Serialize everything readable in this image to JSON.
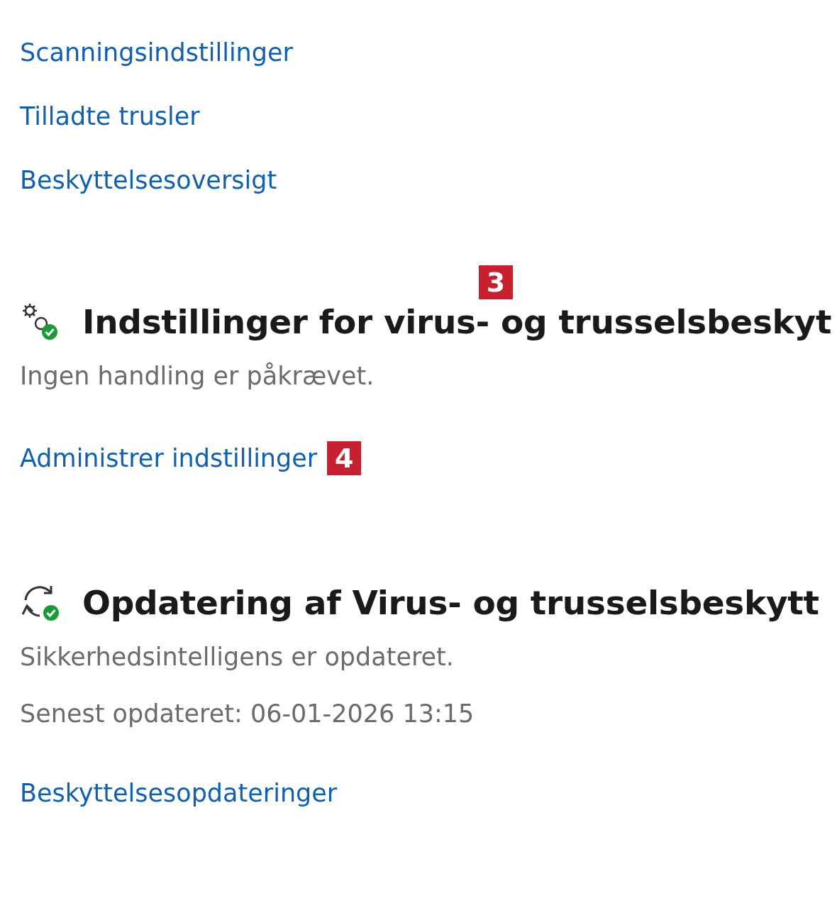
{
  "top_links": [
    "Scanningsindstillinger",
    "Tilladte trusler",
    "Beskyttelsesoversigt"
  ],
  "sections": [
    {
      "kind": "settings",
      "title": "Indstillinger for virus- og trusselsbeskyt",
      "title_badge": "3",
      "lines": [
        "Ingen handling er påkrævet."
      ],
      "link": "Administrer indstillinger",
      "link_badge": "4"
    },
    {
      "kind": "update",
      "title": "Opdatering af Virus- og trusselsbeskytt",
      "lines": [
        "Sikkerhedsintelligens er opdateret.",
        "Senest opdateret: 06-01-2026 13:15"
      ],
      "link": "Beskyttelsesopdateringer"
    }
  ]
}
